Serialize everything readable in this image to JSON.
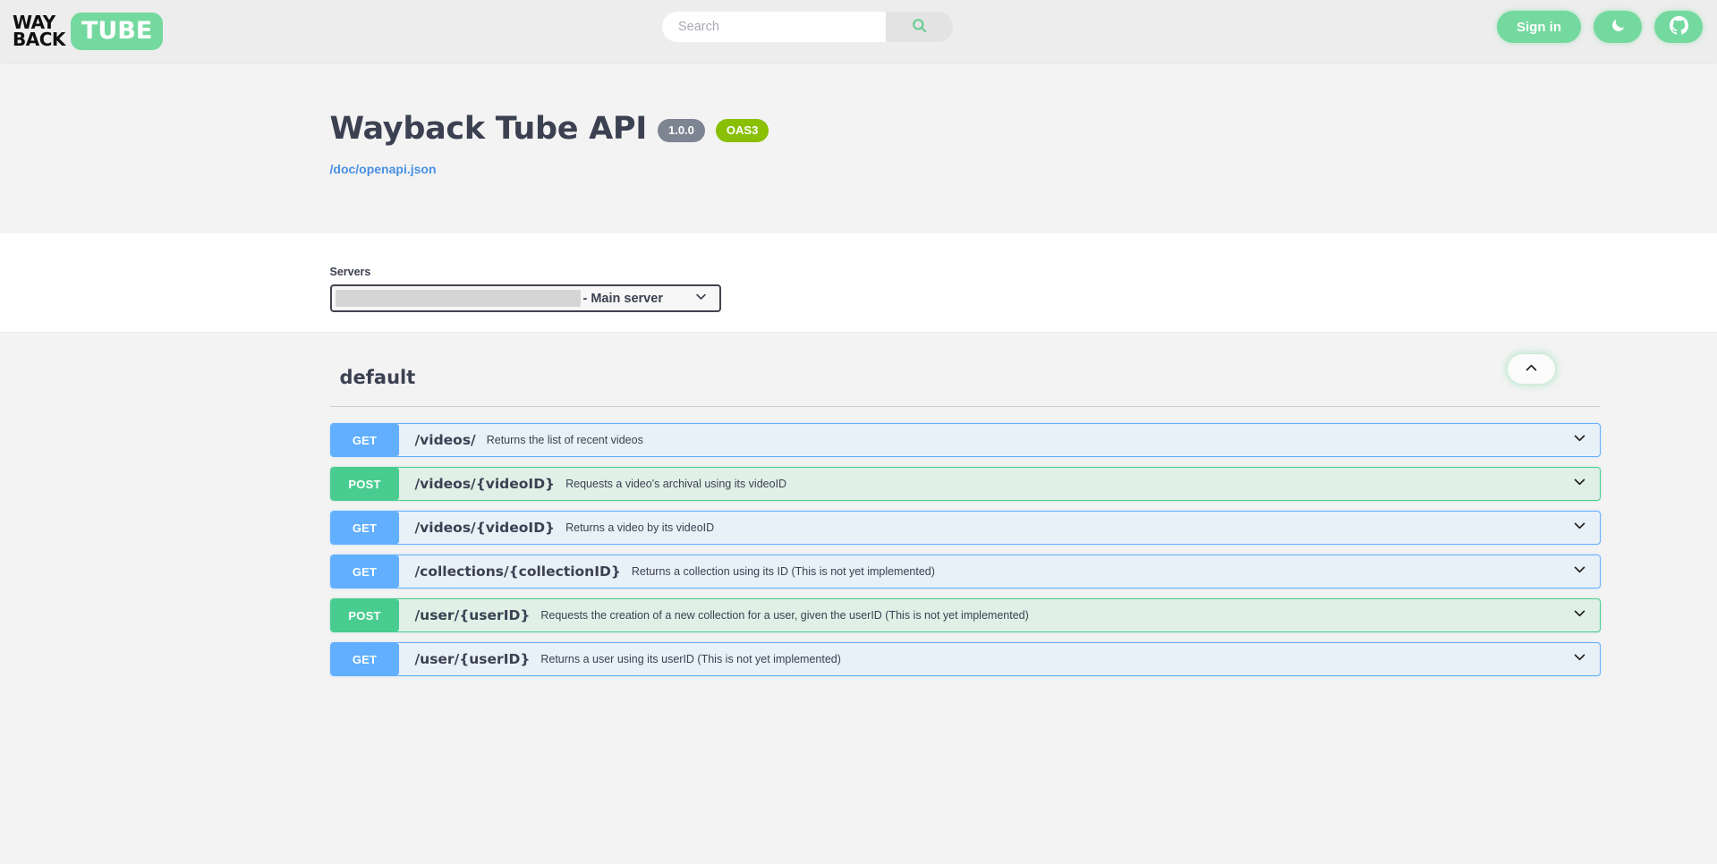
{
  "header": {
    "logo": {
      "line1": "WAY",
      "line2": "BACK",
      "tube": "TUBE"
    },
    "search": {
      "placeholder": "Search",
      "value": "",
      "icon": "search-icon"
    },
    "sign_in_label": "Sign in",
    "theme_toggle_icon": "moon-icon",
    "github_icon": "github-icon",
    "accent_color": "#74d99f"
  },
  "api_info": {
    "title": "Wayback Tube API",
    "version_badge": "1.0.0",
    "spec_badge": "OAS3",
    "spec_link": "/doc/openapi.json",
    "link_color": "#4990e2",
    "version_badge_color": "#7d8492",
    "spec_badge_color": "#89bf04"
  },
  "servers": {
    "label": "Servers",
    "selected_value": "- Main server",
    "caret_icon": "chevron-down-icon"
  },
  "tag_section": {
    "name": "default",
    "collapse_icon": "chevron-up-icon"
  },
  "operations": [
    {
      "method": "GET",
      "type": "get",
      "path": "/videos/",
      "description": "Returns the list of recent videos",
      "caret_icon": "chevron-down-icon"
    },
    {
      "method": "POST",
      "type": "post",
      "path": "/videos/{videoID}",
      "description": "Requests a video's archival using its videoID",
      "caret_icon": "chevron-down-icon"
    },
    {
      "method": "GET",
      "type": "get",
      "path": "/videos/{videoID}",
      "description": "Returns a video by its videoID",
      "caret_icon": "chevron-down-icon"
    },
    {
      "method": "GET",
      "type": "get",
      "path": "/collections/{collectionID}",
      "description": "Returns a collection using its ID (This is not yet implemented)",
      "caret_icon": "chevron-down-icon"
    },
    {
      "method": "POST",
      "type": "post",
      "path": "/user/{userID}",
      "description": "Requests the creation of a new collection for a user, given the userID (This is not yet implemented)",
      "caret_icon": "chevron-down-icon"
    },
    {
      "method": "GET",
      "type": "get",
      "path": "/user/{userID}",
      "description": "Returns a user using its userID (This is not yet implemented)",
      "caret_icon": "chevron-down-icon"
    }
  ],
  "colors": {
    "get_badge": "#61affe",
    "post_badge": "#49cc90",
    "page_background": "#f3f3f3",
    "header_background": "#ededed"
  }
}
